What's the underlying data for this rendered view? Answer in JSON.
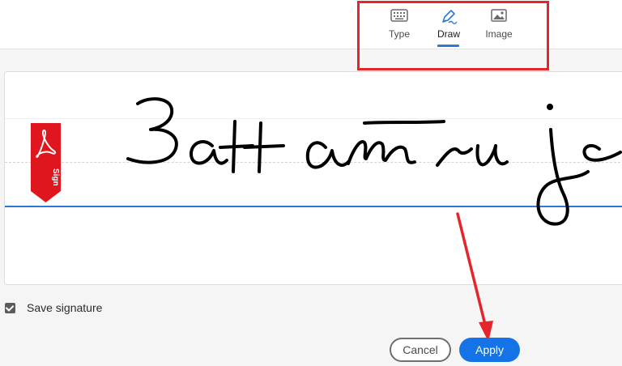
{
  "tabs": [
    {
      "label": "Type",
      "icon": "keyboard-icon"
    },
    {
      "label": "Draw",
      "icon": "pen-icon",
      "active": true
    },
    {
      "label": "Image",
      "icon": "image-icon"
    }
  ],
  "signature": {
    "text": "Zattamrujo",
    "sign_tag_label": "Sign"
  },
  "save_signature": {
    "label": "Save signature",
    "checked": true
  },
  "buttons": {
    "cancel_label": "Cancel",
    "apply_label": "Apply"
  },
  "colors": {
    "accent": "#2d7ad6",
    "apply": "#1473e6",
    "annotation": "#e4252c",
    "sign_tag": "#e0161e"
  }
}
